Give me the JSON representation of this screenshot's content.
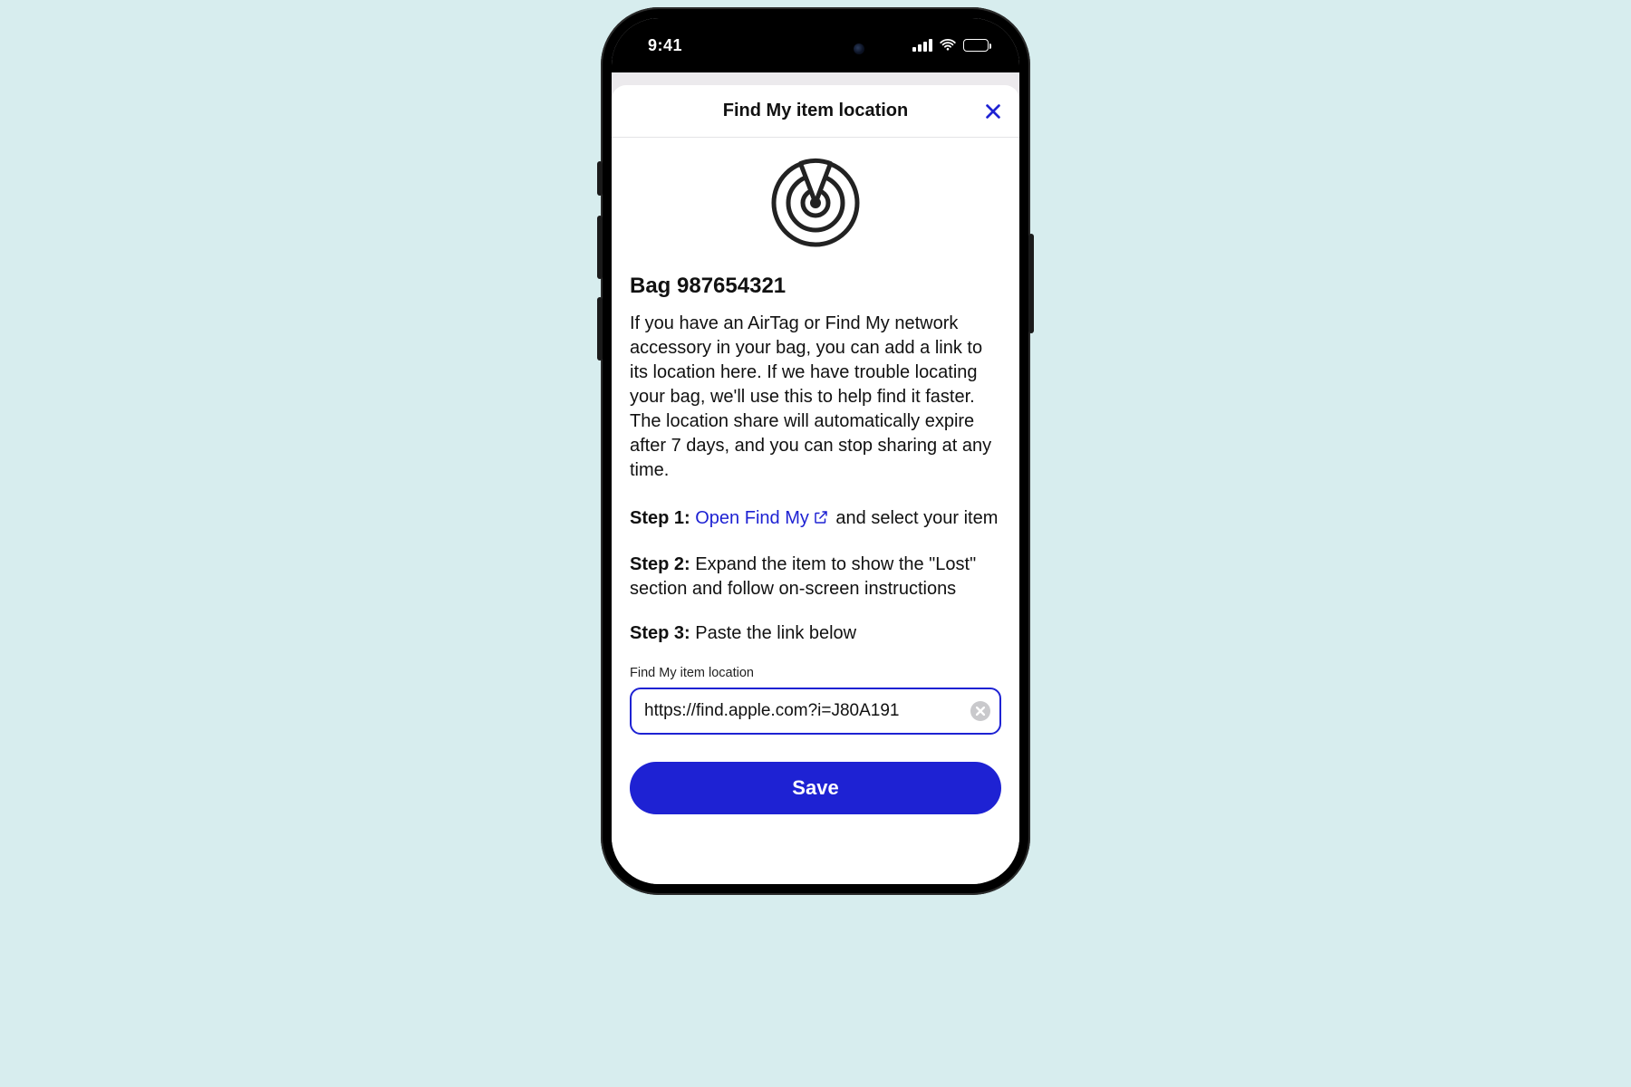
{
  "status": {
    "time": "9:41"
  },
  "sheet": {
    "title": "Find My item location",
    "bag_title": "Bag 987654321",
    "description": "If you have an AirTag or Find My network accessory in your bag, you can add a link to its location here. If we have trouble locating your bag, we'll use this to help find it faster. The location share will automatically expire after 7 days, and you can stop sharing at any time.",
    "step1": {
      "label": "Step 1:",
      "link_text": "Open Find My",
      "after_link": " and select your item"
    },
    "step2": {
      "label": "Step 2:",
      "text": " Expand the item to show the \"Lost\" section and follow on-screen instructions"
    },
    "step3": {
      "label": "Step 3:",
      "text": " Paste the link below"
    },
    "field_label": "Find My item location",
    "field_value": "https://find.apple.com?i=J80A191",
    "save_label": "Save"
  }
}
